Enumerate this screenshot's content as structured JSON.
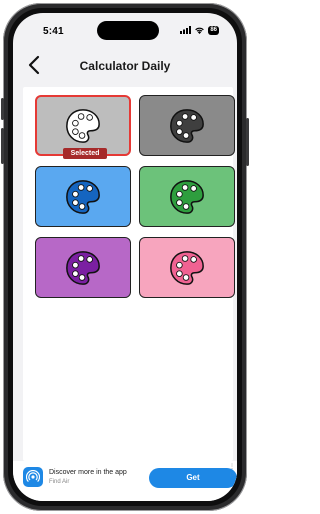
{
  "status_bar": {
    "time": "5:41",
    "battery": "86"
  },
  "navbar": {
    "title": "Calculator Daily"
  },
  "themes": [
    {
      "id": "white",
      "bg": "#bdbdbd",
      "palette": "#ffffff",
      "selected": true
    },
    {
      "id": "gray",
      "bg": "#8a8a8a",
      "palette": "#3f3f3f",
      "selected": false
    },
    {
      "id": "blue",
      "bg": "#5aa8f0",
      "palette": "#1565c0",
      "selected": false
    },
    {
      "id": "green",
      "bg": "#6cc27a",
      "palette": "#2e9e3e",
      "selected": false
    },
    {
      "id": "purple",
      "bg": "#b768c7",
      "palette": "#7b1fa2",
      "selected": false
    },
    {
      "id": "pink",
      "bg": "#f7a5be",
      "palette": "#f06292",
      "selected": false
    }
  ],
  "selected_label": "Selected",
  "ad": {
    "title": "Discover more in the app",
    "subtitle": "Find Air",
    "cta": "Get",
    "dots": "⋮",
    "tag": "▷"
  }
}
